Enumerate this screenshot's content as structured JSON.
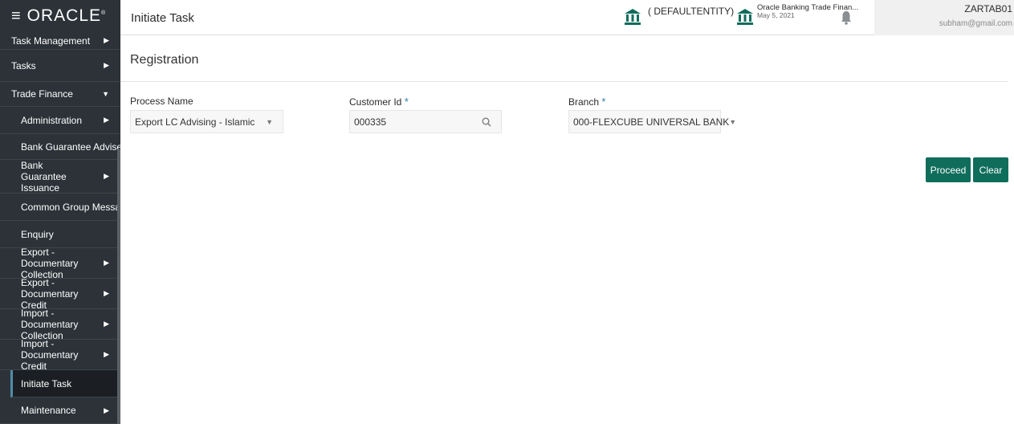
{
  "brand": {
    "menu_icon": "hamburger-icon",
    "logo_text": "ORACLE",
    "logo_mark": "®"
  },
  "sidebar": {
    "items": [
      {
        "label": "Task Management",
        "arrow": "▶"
      },
      {
        "label": "Tasks",
        "arrow": "▶"
      },
      {
        "label": "Trade Finance",
        "arrow": "▼"
      },
      {
        "label": "Administration",
        "arrow": "▶"
      },
      {
        "label": "Bank Guarantee Advise",
        "arrow": "▶"
      },
      {
        "label": "Bank Guarantee Issuance",
        "arrow": "▶"
      },
      {
        "label": "Common Group Message",
        "arrow": ""
      },
      {
        "label": "Enquiry",
        "arrow": ""
      },
      {
        "label": "Export - Documentary Collection",
        "arrow": "▶"
      },
      {
        "label": "Export - Documentary Credit",
        "arrow": "▶"
      },
      {
        "label": "Import - Documentary Collection",
        "arrow": "▶"
      },
      {
        "label": "Import - Documentary Credit",
        "arrow": "▶"
      },
      {
        "label": "Initiate Task",
        "arrow": ""
      },
      {
        "label": "Maintenance",
        "arrow": "▶"
      }
    ]
  },
  "header": {
    "title": "Initiate Task",
    "entity": "( DEFAULTENTITY)",
    "bank_name": "Oracle Banking Trade Finan...",
    "bank_date": "May 5, 2021",
    "user_name": "ZARTAB01",
    "user_email": "subham@gmail.com"
  },
  "main": {
    "section_title": "Registration",
    "fields": {
      "process_name": {
        "label": "Process Name",
        "value": "Export LC Advising - Islamic",
        "caret": "▼"
      },
      "customer_id": {
        "label": "Customer Id",
        "required": "*",
        "value": "000335"
      },
      "branch": {
        "label": "Branch",
        "required": "*",
        "value": "000-FLEXCUBE UNIVERSAL BANK",
        "caret": "▼"
      }
    },
    "buttons": {
      "proceed": "Proceed",
      "clear": "Clear"
    }
  },
  "colors": {
    "sidebar_bg": "#2c3238",
    "accent": "#0f6d5b",
    "required": "#2f7ea3"
  }
}
